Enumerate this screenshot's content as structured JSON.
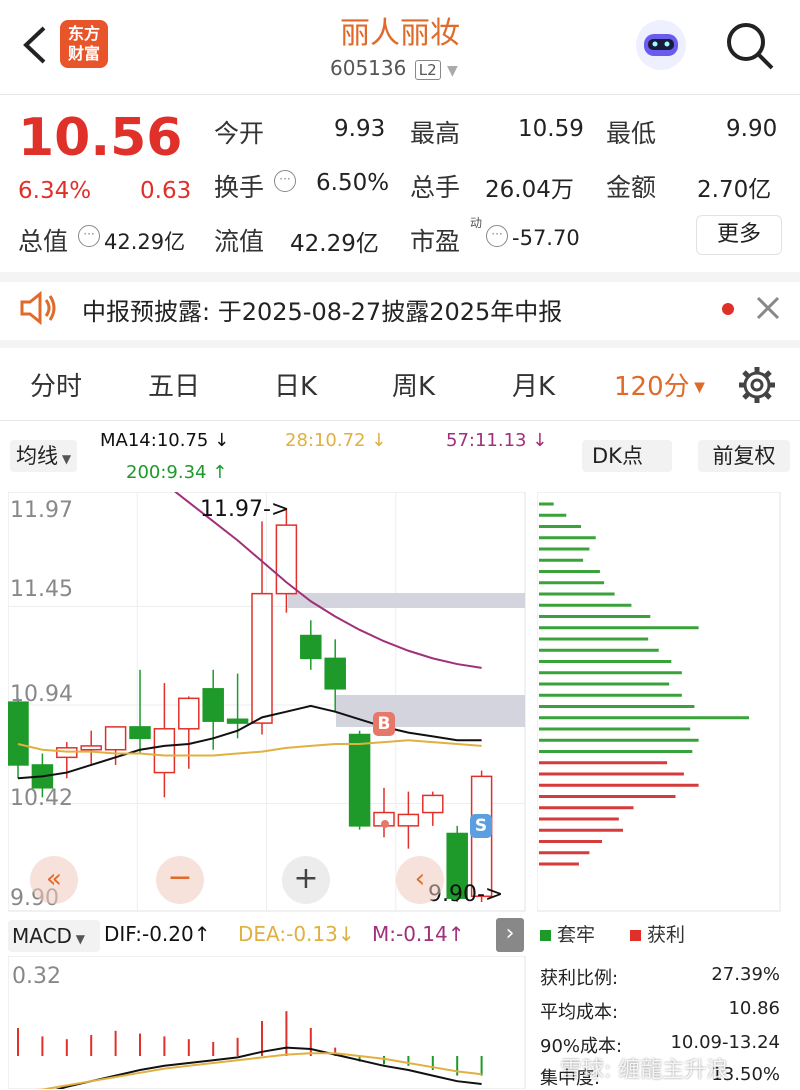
{
  "header": {
    "title": "丽人丽妆",
    "code": "605136",
    "level": "L2",
    "logo_text": "东方财富"
  },
  "quote": {
    "price": "10.56",
    "change_pct": "6.34%",
    "change": "0.63",
    "open_label": "今开",
    "open": "9.93",
    "high_label": "最高",
    "high": "10.59",
    "low_label": "最低",
    "low": "9.90",
    "turnover_label": "换手",
    "turnover": "6.50%",
    "volume_label": "总手",
    "volume": "26.04万",
    "amount_label": "金额",
    "amount": "2.70亿",
    "mktcap_label": "总值",
    "mktcap": "42.29亿",
    "float_label": "流值",
    "float": "42.29亿",
    "pe_label": "市盈",
    "pe_sup": "动",
    "pe": "-57.70",
    "more_label": "更多"
  },
  "notice": {
    "text": "中报预披露: 于2025-08-27披露2025年中报"
  },
  "tabs": [
    "分时",
    "五日",
    "日K",
    "周K",
    "月K",
    "120分"
  ],
  "indicators": {
    "ma_selector": "均线",
    "ma14": "MA14:10.75",
    "ma28": "28:10.72",
    "ma57": "57:11.13",
    "ma200": "200:9.34",
    "dk_label": "DK点",
    "adjust_label": "前复权",
    "macd_selector": "MACD",
    "dif": "DIF:-0.20",
    "dea": "DEA:-0.13",
    "m": "M:-0.14"
  },
  "chart": {
    "price_ticks": [
      "11.97",
      "11.45",
      "10.94",
      "10.42",
      "9.90"
    ],
    "max_marker": "11.97",
    "min_marker": "9.90",
    "macd_tick": "0.32",
    "buy_marker": "B",
    "sell_marker": "S"
  },
  "chip": {
    "legend_trapped": "套牢",
    "legend_profit": "获利",
    "stats": [
      {
        "label": "获利比例:",
        "value": "27.39%"
      },
      {
        "label": "平均成本:",
        "value": "10.86"
      },
      {
        "label": "90%成本:",
        "value": "10.09-13.24"
      },
      {
        "label": "集中度:",
        "value": "13.50%"
      }
    ]
  },
  "watermark": "雪球: 缠龍主升浪",
  "colors": {
    "up": "#e0302a",
    "down": "#1e9a2a",
    "accent": "#e06a2a",
    "ma57": "#a0307a",
    "ma28": "#e0b040"
  },
  "chart_data": {
    "type": "candlestick",
    "ylim": [
      9.9,
      11.97
    ],
    "candles": [
      {
        "o": 10.95,
        "c": 10.62,
        "h": 10.97,
        "l": 10.55
      },
      {
        "o": 10.62,
        "c": 10.5,
        "h": 10.68,
        "l": 10.45
      },
      {
        "o": 10.66,
        "c": 10.71,
        "h": 10.74,
        "l": 10.55
      },
      {
        "o": 10.7,
        "c": 10.72,
        "h": 10.8,
        "l": 10.62
      },
      {
        "o": 10.7,
        "c": 10.82,
        "h": 10.82,
        "l": 10.62
      },
      {
        "o": 10.82,
        "c": 10.76,
        "h": 11.12,
        "l": 10.68
      },
      {
        "o": 10.58,
        "c": 10.81,
        "h": 11.05,
        "l": 10.45
      },
      {
        "o": 10.81,
        "c": 10.97,
        "h": 10.98,
        "l": 10.6
      },
      {
        "o": 11.02,
        "c": 10.85,
        "h": 11.12,
        "l": 10.7
      },
      {
        "o": 10.86,
        "c": 10.84,
        "h": 11.1,
        "l": 10.76
      },
      {
        "o": 10.84,
        "c": 11.52,
        "h": 11.9,
        "l": 10.78
      },
      {
        "o": 11.52,
        "c": 11.88,
        "h": 11.97,
        "l": 11.42
      },
      {
        "o": 11.3,
        "c": 11.18,
        "h": 11.38,
        "l": 11.12
      },
      {
        "o": 11.18,
        "c": 11.02,
        "h": 11.28,
        "l": 10.9
      },
      {
        "o": 10.78,
        "c": 10.3,
        "h": 10.8,
        "l": 10.28
      },
      {
        "o": 10.3,
        "c": 10.37,
        "h": 10.5,
        "l": 10.24
      },
      {
        "o": 10.3,
        "c": 10.36,
        "h": 10.48,
        "l": 10.18
      },
      {
        "o": 10.37,
        "c": 10.46,
        "h": 10.48,
        "l": 10.3
      },
      {
        "o": 10.26,
        "c": 9.92,
        "h": 10.3,
        "l": 9.9
      },
      {
        "o": 9.93,
        "c": 10.56,
        "h": 10.59,
        "l": 9.9
      }
    ],
    "ma14": [
      10.55,
      10.56,
      10.58,
      10.62,
      10.66,
      10.7,
      10.72,
      10.73,
      10.76,
      10.8,
      10.87,
      10.9,
      10.93,
      10.9,
      10.86,
      10.82,
      10.79,
      10.77,
      10.75,
      10.75
    ],
    "ma28": [
      10.73,
      10.7,
      10.69,
      10.69,
      10.68,
      10.68,
      10.67,
      10.67,
      10.67,
      10.68,
      10.69,
      10.71,
      10.72,
      10.73,
      10.73,
      10.74,
      10.75,
      10.74,
      10.73,
      10.72
    ],
    "ma57": [
      12.3,
      12.2,
      12.1,
      12.0,
      11.9,
      11.8,
      11.69,
      11.58,
      11.48,
      11.4,
      11.33,
      11.27,
      11.22,
      11.18,
      11.15,
      11.13
    ],
    "macd_m": [
      0.2,
      0.14,
      0.12,
      0.15,
      0.18,
      0.16,
      0.14,
      0.12,
      0.1,
      0.13,
      0.25,
      0.32,
      0.2,
      0.06,
      -0.04,
      -0.06,
      -0.07,
      -0.1,
      -0.14,
      -0.14
    ],
    "dif": [
      -0.3,
      -0.27,
      -0.22,
      -0.18,
      -0.14,
      -0.1,
      -0.07,
      -0.05,
      -0.03,
      -0.01,
      0.03,
      0.06,
      0.05,
      0.01,
      -0.03,
      -0.07,
      -0.1,
      -0.14,
      -0.18,
      -0.2
    ],
    "dea": [
      -0.25,
      -0.24,
      -0.21,
      -0.18,
      -0.15,
      -0.12,
      -0.09,
      -0.07,
      -0.05,
      -0.03,
      -0.01,
      0.01,
      0.02,
      0.02,
      0.0,
      -0.02,
      -0.05,
      -0.08,
      -0.11,
      -0.13
    ],
    "chip_rows": [
      {
        "len": 0.07,
        "kind": "profit"
      },
      {
        "len": 0.13,
        "kind": "profit"
      },
      {
        "len": 0.2,
        "kind": "profit"
      },
      {
        "len": 0.27,
        "kind": "profit"
      },
      {
        "len": 0.24,
        "kind": "profit"
      },
      {
        "len": 0.21,
        "kind": "profit"
      },
      {
        "len": 0.29,
        "kind": "profit"
      },
      {
        "len": 0.31,
        "kind": "profit"
      },
      {
        "len": 0.36,
        "kind": "profit"
      },
      {
        "len": 0.44,
        "kind": "profit"
      },
      {
        "len": 0.53,
        "kind": "profit"
      },
      {
        "len": 0.76,
        "kind": "profit"
      },
      {
        "len": 0.52,
        "kind": "profit"
      },
      {
        "len": 0.57,
        "kind": "profit"
      },
      {
        "len": 0.63,
        "kind": "profit"
      },
      {
        "len": 0.68,
        "kind": "profit"
      },
      {
        "len": 0.62,
        "kind": "profit"
      },
      {
        "len": 0.68,
        "kind": "profit"
      },
      {
        "len": 0.74,
        "kind": "profit"
      },
      {
        "len": 1.0,
        "kind": "profit"
      },
      {
        "len": 0.72,
        "kind": "profit"
      },
      {
        "len": 0.76,
        "kind": "profit"
      },
      {
        "len": 0.73,
        "kind": "profit"
      },
      {
        "len": 0.61,
        "kind": "trapped"
      },
      {
        "len": 0.69,
        "kind": "trapped"
      },
      {
        "len": 0.76,
        "kind": "trapped"
      },
      {
        "len": 0.65,
        "kind": "trapped"
      },
      {
        "len": 0.45,
        "kind": "trapped"
      },
      {
        "len": 0.38,
        "kind": "trapped"
      },
      {
        "len": 0.4,
        "kind": "trapped"
      },
      {
        "len": 0.3,
        "kind": "trapped"
      },
      {
        "len": 0.24,
        "kind": "trapped"
      },
      {
        "len": 0.19,
        "kind": "trapped"
      }
    ]
  }
}
